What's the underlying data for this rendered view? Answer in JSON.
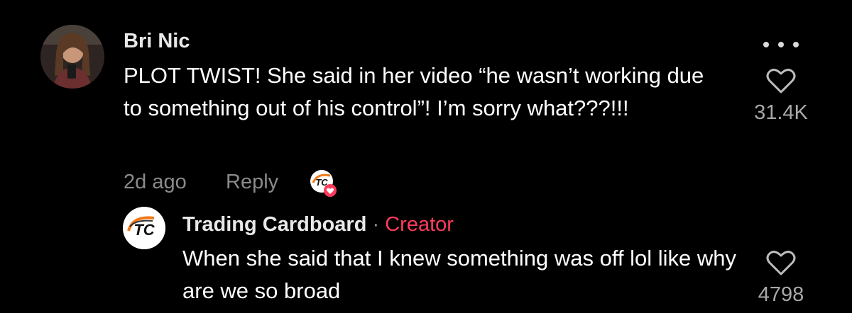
{
  "comment": {
    "author": "Bri Nic",
    "text": "PLOT TWIST! She said in her video “he wasn’t working due to something out of his control”! I’m sorry what???!!!",
    "time": "2d ago",
    "reply_label": "Reply",
    "like_count": "31.4K",
    "more_icon": "more-horizontal-icon",
    "like_icon": "heart-outline-icon"
  },
  "reply": {
    "author": "Trading Cardboard",
    "separator": "·",
    "badge": "Creator",
    "text": "When she said that I knew something was off lol like why are we so broad",
    "like_count": "4798",
    "avatar_text": "TC"
  },
  "colors": {
    "background": "#000000",
    "creator_accent": "#ff3b5c",
    "muted_text": "#8a8a8a"
  }
}
